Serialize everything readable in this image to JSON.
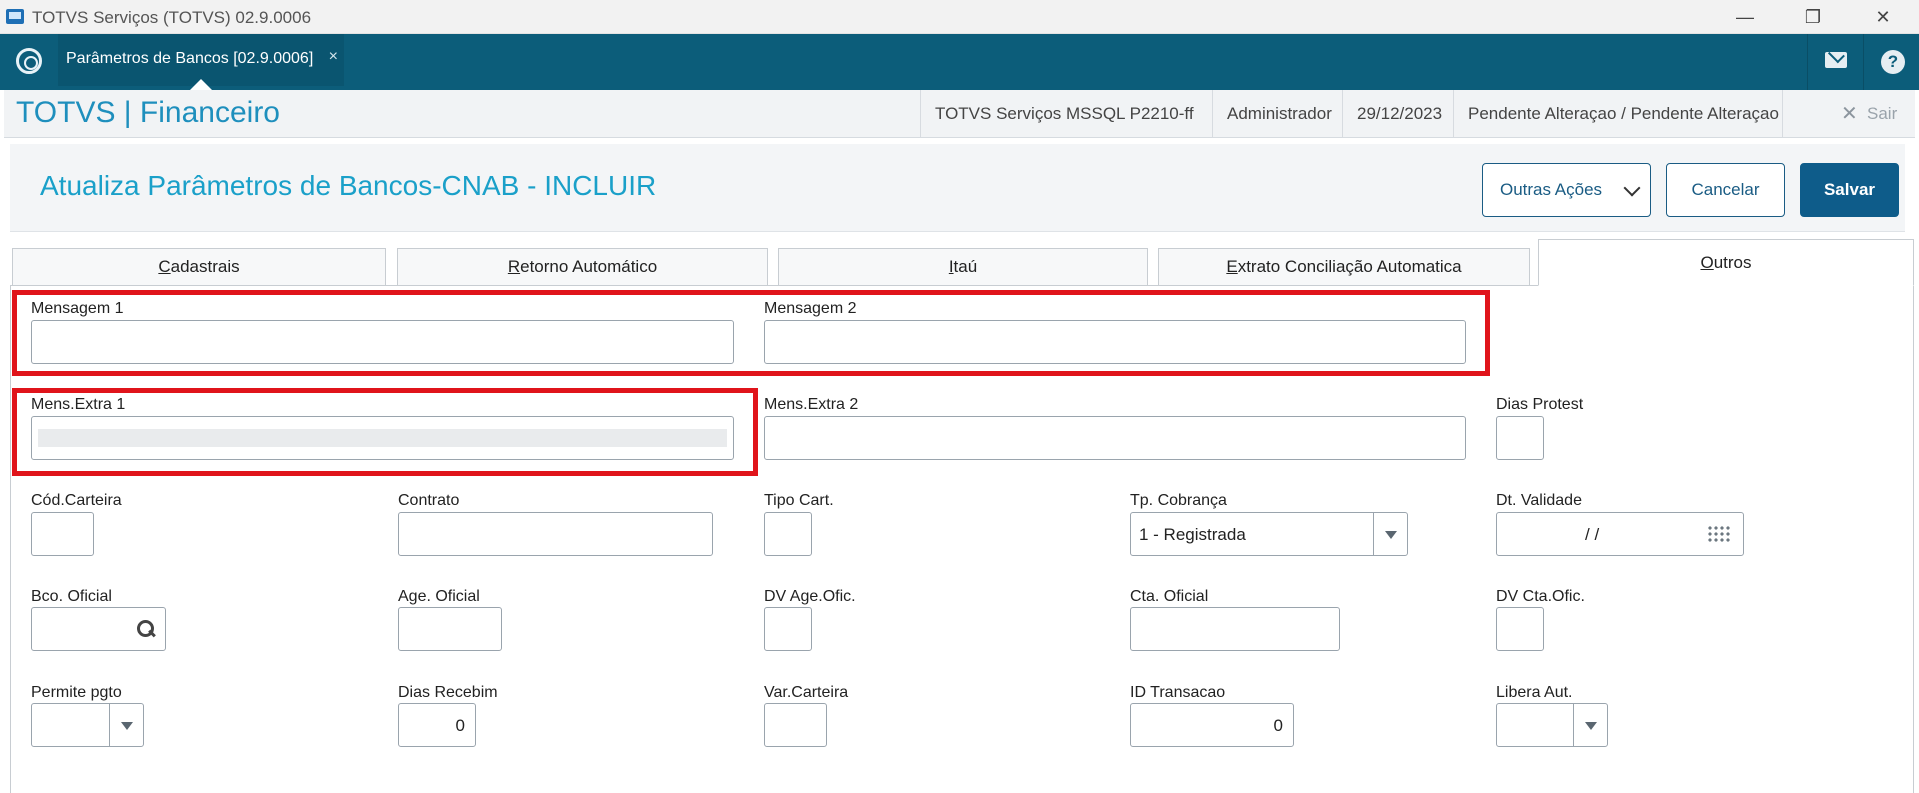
{
  "window": {
    "title": "TOTVS Serviços (TOTVS) 02.9.0006",
    "minimize": "—",
    "maximize": "❐",
    "close": "✕"
  },
  "appbar": {
    "tab_label": "Parâmetros de Bancos [02.9.0006]",
    "tab_close": "×",
    "icons": [
      "mail-icon",
      "help-icon"
    ],
    "help_glyph": "?"
  },
  "product": {
    "name": "TOTVS | Financeiro",
    "environment": "TOTVS Serviços MSSQL P2210-ff",
    "user": "Administrador",
    "date": "29/12/2023",
    "status": "Pendente Alteraçao / Pendente Alteraçao",
    "exit_label": "Sair",
    "exit_glyph": "✕"
  },
  "page": {
    "title": "Atualiza Parâmetros de Bancos-CNAB - INCLUIR",
    "actions": {
      "more": "Outras Ações",
      "cancel": "Cancelar",
      "save": "Salvar"
    }
  },
  "tabs": [
    {
      "first": "C",
      "rest": "adastrais"
    },
    {
      "first": "R",
      "rest": "etorno Automático"
    },
    {
      "first": "I",
      "rest": "taú"
    },
    {
      "first": "E",
      "rest": "xtrato Conciliação Automatica"
    },
    {
      "first": "O",
      "rest": "utros"
    }
  ],
  "fields": {
    "mensagem1": {
      "label": "Mensagem 1",
      "value": ""
    },
    "mensagem2": {
      "label": "Mensagem 2",
      "value": ""
    },
    "mens_extra1": {
      "label": "Mens.Extra 1",
      "value": ""
    },
    "mens_extra2": {
      "label": "Mens.Extra 2",
      "value": ""
    },
    "dias_protest": {
      "label": "Dias Protest",
      "value": ""
    },
    "cod_carteira": {
      "label": "Cód.Carteira",
      "value": ""
    },
    "contrato": {
      "label": "Contrato",
      "value": ""
    },
    "tipo_cart": {
      "label": "Tipo Cart.",
      "value": ""
    },
    "tp_cobranca": {
      "label": "Tp. Cobrança",
      "value": "1 - Registrada"
    },
    "dt_validade": {
      "label": "Dt. Validade",
      "value": "/ /"
    },
    "bco_oficial": {
      "label": "Bco. Oficial",
      "value": ""
    },
    "age_oficial": {
      "label": "Age. Oficial",
      "value": ""
    },
    "dv_age_ofic": {
      "label": "DV Age.Ofic.",
      "value": ""
    },
    "cta_oficial": {
      "label": "Cta. Oficial",
      "value": ""
    },
    "dv_cta_ofic": {
      "label": "DV Cta.Ofic.",
      "value": ""
    },
    "permite_pgto": {
      "label": "Permite pgto",
      "value": ""
    },
    "dias_recebim": {
      "label": "Dias Recebim",
      "value": "0"
    },
    "var_carteira": {
      "label": "Var.Carteira",
      "value": ""
    },
    "id_transacao": {
      "label": "ID Transacao",
      "value": "0"
    },
    "libera_aut": {
      "label": "Libera Aut.",
      "value": ""
    }
  },
  "colors": {
    "accent": "#1aa0c9",
    "appbar": "#0c5d7a",
    "primary_button": "#0e5c8a",
    "highlight": "#e0141b"
  }
}
